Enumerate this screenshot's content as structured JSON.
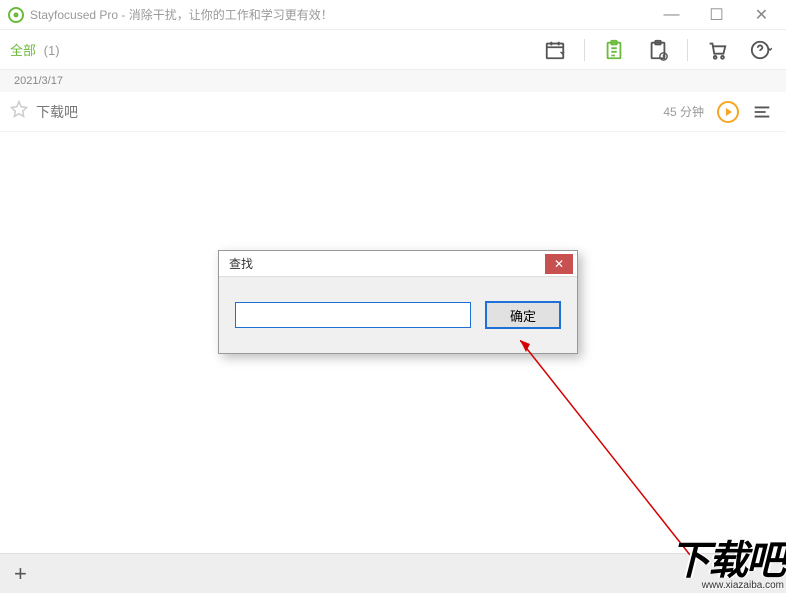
{
  "window": {
    "title": "Stayfocused Pro - 消除干扰，让你的工作和学习更有效！",
    "minimize": "—",
    "maximize": "☐",
    "close": "✕"
  },
  "toolbar": {
    "filter_label": "全部",
    "filter_count": "(1)"
  },
  "date_header": "2021/3/17",
  "task": {
    "name": "下载吧",
    "duration": "45 分钟"
  },
  "bottom": {
    "add": "+"
  },
  "dialog": {
    "title": "查找",
    "close": "✕",
    "input_value": "",
    "ok": "确定"
  },
  "watermark": {
    "text": "下载吧",
    "url": "www.xiazaiba.com"
  }
}
